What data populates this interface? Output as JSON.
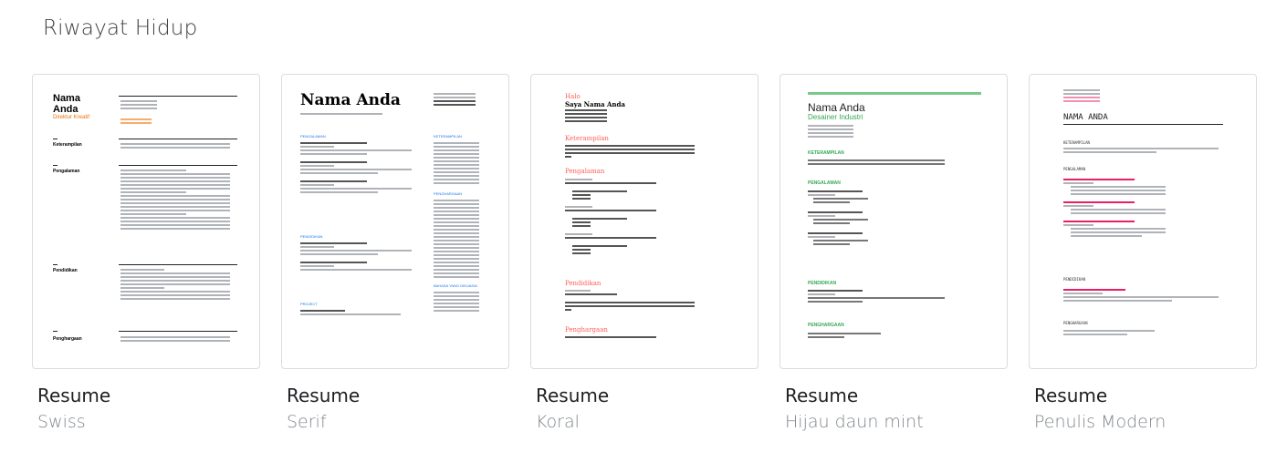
{
  "section": {
    "title": "Riwayat Hidup"
  },
  "templates": [
    {
      "title": "Resume",
      "subtitle": "Swiss",
      "preview": {
        "name": "Nama Anda",
        "role": "Direktur Kreatif",
        "sections": [
          "Keterampilan",
          "Pengalaman",
          "Pendidikan",
          "Penghargaan"
        ]
      }
    },
    {
      "title": "Resume",
      "subtitle": "Serif",
      "preview": {
        "name": "Nama Anda",
        "sections": [
          "PENGALAMAN",
          "PENDIDIKAN",
          "PROJECT",
          "KETERAMPILAN",
          "PENGHARGAAN",
          "BAHASA YANG DIKUASAI"
        ]
      }
    },
    {
      "title": "Resume",
      "subtitle": "Koral",
      "preview": {
        "greeting": "Halo",
        "name": "Saya Nama Anda",
        "sections": [
          "Keterampilan",
          "Pengalaman",
          "Pendidikan",
          "Penghargaan"
        ]
      }
    },
    {
      "title": "Resume",
      "subtitle": "Hijau daun mint",
      "preview": {
        "name": "Nama Anda",
        "role": "Desainer Industri",
        "sections": [
          "KETERAMPILAN",
          "PENGALAMAN",
          "PENDIDIKAN",
          "PENGHARGAAN"
        ]
      }
    },
    {
      "title": "Resume",
      "subtitle": "Penulis Modern",
      "preview": {
        "name": "NAMA ANDA",
        "sections": [
          "KETERAMPILAN",
          "PENGALAMAN",
          "PENDIDIKAN",
          "PENGHARGAAN"
        ]
      }
    }
  ],
  "colors": {
    "swiss_accent": "#e8710a",
    "serif_accent": "#1a73e8",
    "koral_accent": "#ff5e57",
    "mint_accent": "#34a853",
    "modern_accent": "#e91e63"
  }
}
